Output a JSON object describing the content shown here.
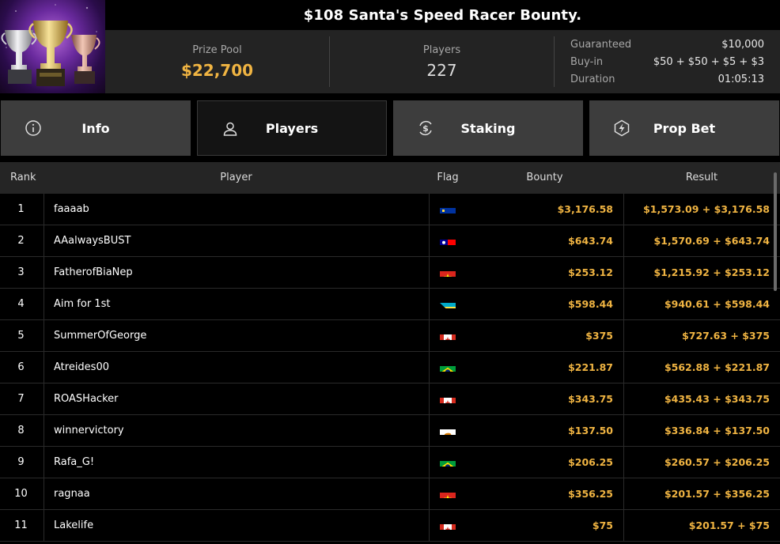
{
  "tournament": {
    "title": "$108 Santa's Speed Racer Bounty."
  },
  "stats": {
    "prize_pool_label": "Prize Pool",
    "prize_pool_value": "$22,700",
    "players_label": "Players",
    "players_value": "227",
    "guaranteed_label": "Guaranteed",
    "guaranteed_value": "$10,000",
    "buyin_label": "Buy-in",
    "buyin_value": "$50 + $50 + $5 + $3",
    "duration_label": "Duration",
    "duration_value": "01:05:13"
  },
  "tabs": [
    {
      "label": "Info",
      "icon": "info-icon",
      "active": false
    },
    {
      "label": "Players",
      "icon": "user-icon",
      "active": true
    },
    {
      "label": "Staking",
      "icon": "dollar-cycle-icon",
      "active": false
    },
    {
      "label": "Prop Bet",
      "icon": "bolt-icon",
      "active": false
    }
  ],
  "table": {
    "columns": [
      "Rank",
      "Player",
      "Flag",
      "Bounty",
      "Result"
    ],
    "rows": [
      {
        "rank": "1",
        "player": "faaaab",
        "flag": "liechtenstein",
        "bounty": "$3,176.58",
        "result": "$1,573.09 + $3,176.58"
      },
      {
        "rank": "2",
        "player": "AAalwaysBUST",
        "flag": "taiwan",
        "bounty": "$643.74",
        "result": "$1,570.69 + $643.74"
      },
      {
        "rank": "3",
        "player": "FatherofBiaNep",
        "flag": "vietnam",
        "bounty": "$253.12",
        "result": "$1,215.92 + $253.12"
      },
      {
        "rank": "4",
        "player": "Aim for 1st",
        "flag": "bahamas",
        "bounty": "$598.44",
        "result": "$940.61 + $598.44"
      },
      {
        "rank": "5",
        "player": "SummerOfGeorge",
        "flag": "canada",
        "bounty": "$375",
        "result": "$727.63 + $375"
      },
      {
        "rank": "6",
        "player": "Atreides00",
        "flag": "brazil",
        "bounty": "$221.87",
        "result": "$562.88 + $221.87"
      },
      {
        "rank": "7",
        "player": "ROASHacker",
        "flag": "canada",
        "bounty": "$343.75",
        "result": "$435.43 + $343.75"
      },
      {
        "rank": "8",
        "player": "winnervictory",
        "flag": "cyprus",
        "bounty": "$137.50",
        "result": "$336.84 + $137.50"
      },
      {
        "rank": "9",
        "player": "Rafa_G!",
        "flag": "brazil",
        "bounty": "$206.25",
        "result": "$260.57 + $206.25"
      },
      {
        "rank": "10",
        "player": "ragnaa",
        "flag": "vietnam",
        "bounty": "$356.25",
        "result": "$201.57 + $356.25"
      },
      {
        "rank": "11",
        "player": "Lakelife",
        "flag": "canada",
        "bounty": "$75",
        "result": "$201.57 + $75"
      }
    ]
  },
  "colors": {
    "accent_gold": "#f0b442",
    "tab_bg": "#3d3d3d",
    "tab_active_bg": "#141414",
    "panel_bg": "#232323"
  }
}
